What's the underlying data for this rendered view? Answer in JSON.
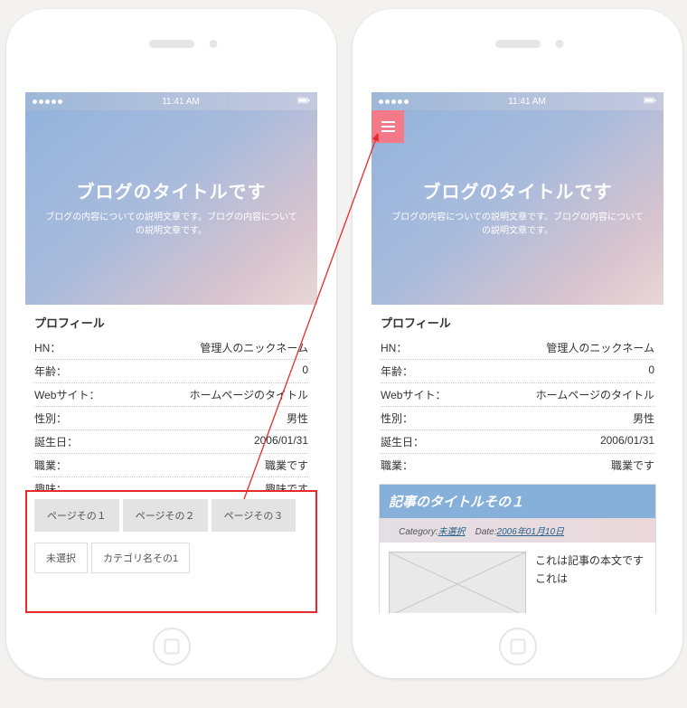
{
  "status_time": "11:41 AM",
  "hero": {
    "title": "ブログのタイトルです",
    "desc": "ブログの内容についての説明文章です。ブログの内容についての説明文章です。"
  },
  "profile": {
    "heading": "プロフィール",
    "rows": [
      {
        "k": "HN：",
        "v": "管理人のニックネーム"
      },
      {
        "k": "年齢：",
        "v": "0"
      },
      {
        "k": "Webサイト：",
        "v": "ホームページのタイトル"
      },
      {
        "k": "性別：",
        "v": "男性"
      },
      {
        "k": "誕生日：",
        "v": "2006/01/31"
      },
      {
        "k": "職業：",
        "v": "職業です"
      },
      {
        "k": "趣味：",
        "v": "趣味です"
      }
    ]
  },
  "pages": [
    "ページその１",
    "ページその２",
    "ページその３"
  ],
  "categories": [
    "未選択",
    "カテゴリ名その1"
  ],
  "article": {
    "title": "記事のタイトルその１",
    "cat_label": "Category:",
    "cat_value": "未選択",
    "date_label": "Date:",
    "date_value": "2006年01月10日",
    "body": "これは記事の本文です　これは"
  }
}
